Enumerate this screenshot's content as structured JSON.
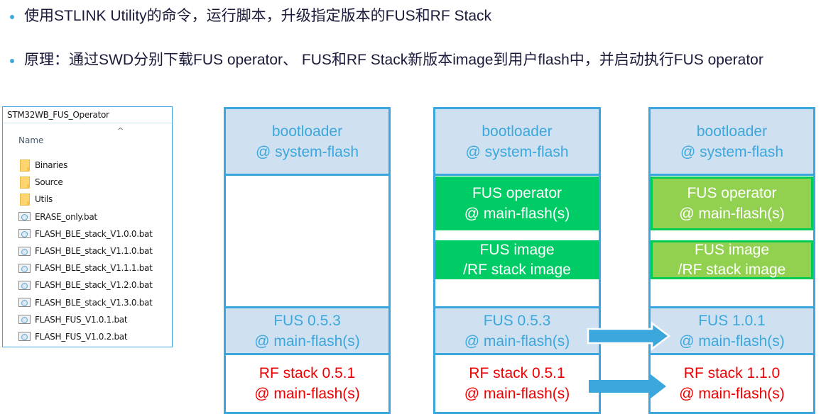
{
  "bullets": [
    "使用STLINK Utility的命令，运行脚本，升级指定版本的FUS和RF Stack",
    "原理：通过SWD分别下载FUS operator、 FUS和RF Stack新版本image到用户flash中，并启动执行FUS operator"
  ],
  "explorer": {
    "title": "STM32WB_FUS_Operator",
    "column_header": "Name",
    "sort_icon": "chevron-up-icon",
    "items": [
      {
        "name": "Binaries",
        "type": "folder"
      },
      {
        "name": "Source",
        "type": "folder"
      },
      {
        "name": "Utils",
        "type": "folder"
      },
      {
        "name": "ERASE_only.bat",
        "type": "bat"
      },
      {
        "name": "FLASH_BLE_stack_V1.0.0.bat",
        "type": "bat"
      },
      {
        "name": "FLASH_BLE_stack_V1.1.0.bat",
        "type": "bat"
      },
      {
        "name": "FLASH_BLE_stack_V1.1.1.bat",
        "type": "bat"
      },
      {
        "name": "FLASH_BLE_stack_V1.2.0.bat",
        "type": "bat"
      },
      {
        "name": "FLASH_BLE_stack_V1.3.0.bat",
        "type": "bat"
      },
      {
        "name": "FLASH_FUS_V1.0.1.bat",
        "type": "bat"
      },
      {
        "name": "FLASH_FUS_V1.0.2.bat",
        "type": "bat"
      }
    ]
  },
  "columns": [
    {
      "bootloader": [
        "bootloader",
        "@ system-flash"
      ],
      "fus": [
        "FUS 0.5.3",
        "@ main-flash(s)"
      ],
      "rf": [
        "RF stack 0.5.1",
        "@ main-flash(s)"
      ]
    },
    {
      "bootloader": [
        "bootloader",
        "@ system-flash"
      ],
      "operator": [
        "FUS operator",
        "@ main-flash(s)"
      ],
      "image": [
        "FUS image",
        "/RF stack image"
      ],
      "fus": [
        "FUS 0.5.3",
        "@ main-flash(s)"
      ],
      "rf": [
        "RF stack 0.5.1",
        "@ main-flash(s)"
      ]
    },
    {
      "bootloader": [
        "bootloader",
        "@ system-flash"
      ],
      "operator": [
        "FUS operator",
        "@ main-flash(s)"
      ],
      "image": [
        "FUS image",
        "/RF stack image"
      ],
      "fus": [
        "FUS 1.0.1",
        "@ main-flash(s)"
      ],
      "rf": [
        "RF stack 1.1.0",
        "@ main-flash(s)"
      ]
    }
  ],
  "colors": {
    "accent_blue": "#3ca7dd",
    "light_blue_fill": "#cfe1f1",
    "green_operator": "#00cc66",
    "green_light": "#92d050",
    "rf_red": "#ee0000"
  }
}
